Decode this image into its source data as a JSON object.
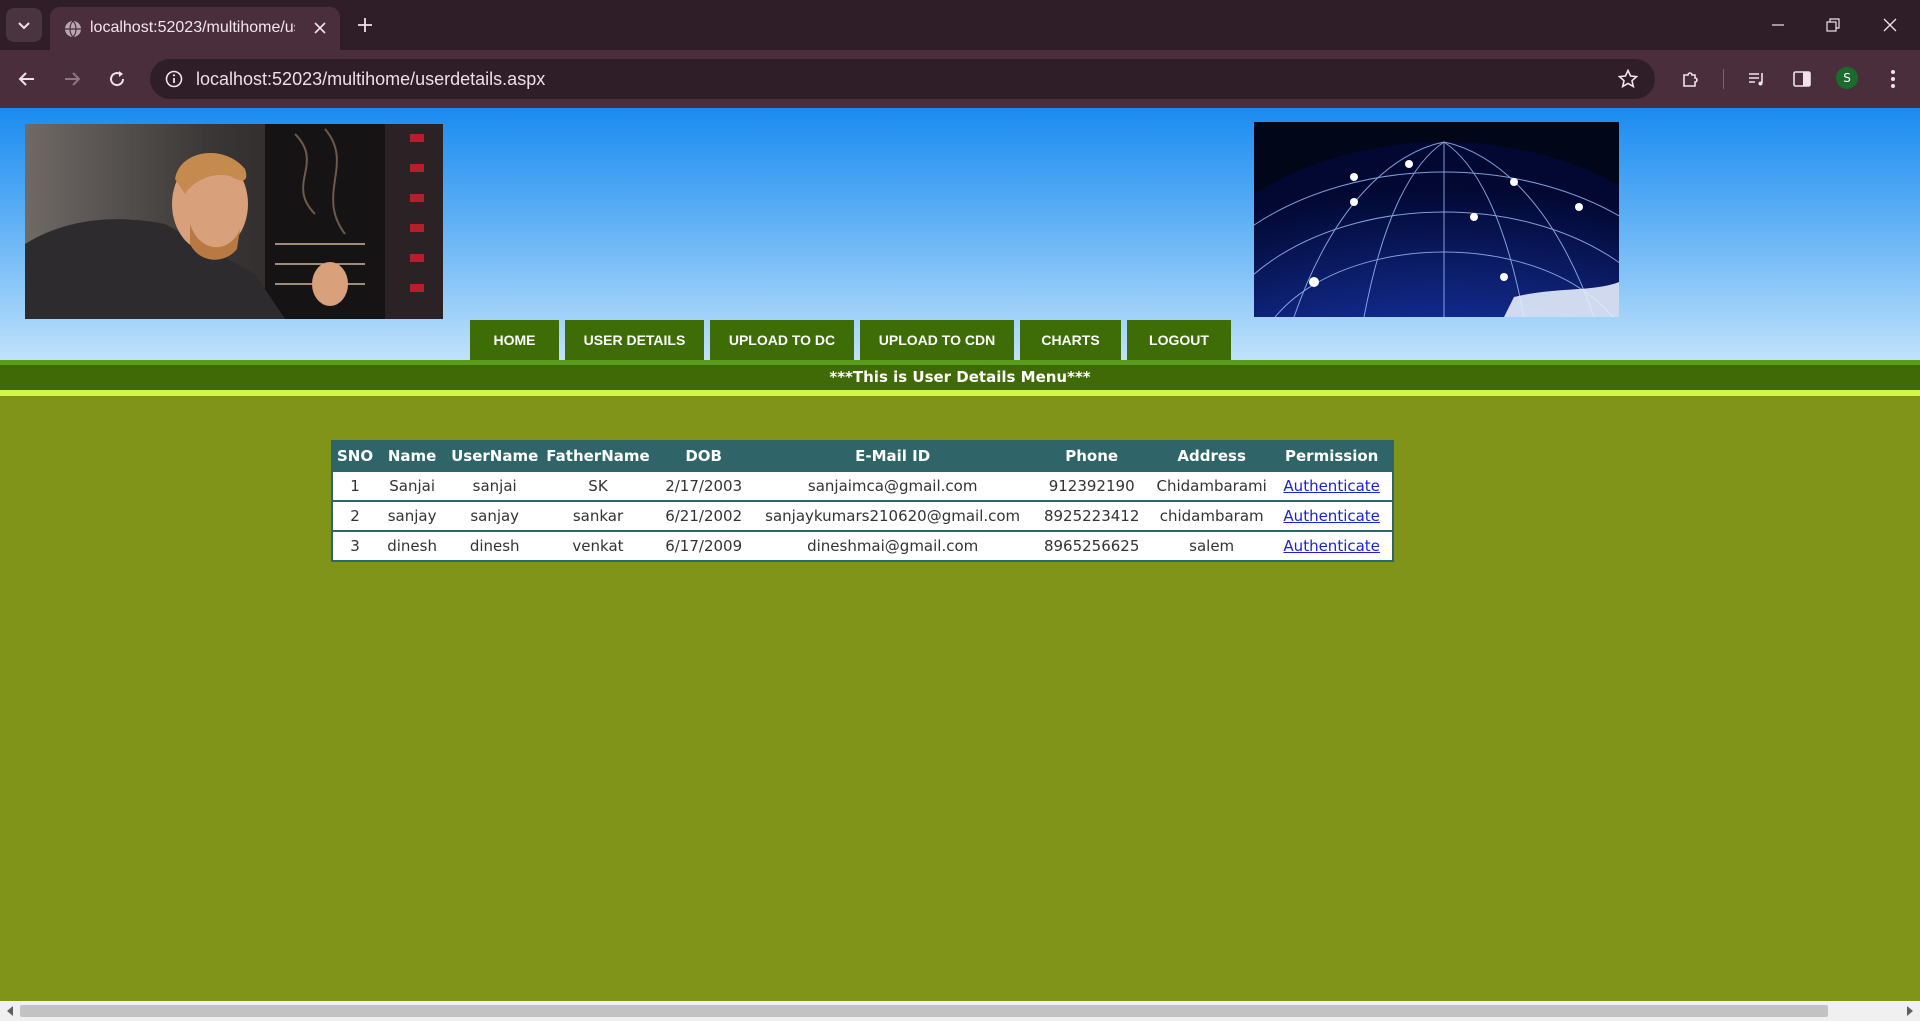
{
  "browser": {
    "tab_title": "localhost:52023/multihome/userdetails.aspx",
    "url": "localhost:52023/multihome/userdetails.aspx",
    "profile_initial": "S"
  },
  "page": {
    "menu": [
      "HOME",
      "USER DETAILS",
      "UPLOAD TO DC",
      "UPLOAD TO CDN",
      "CHARTS",
      "LOGOUT"
    ],
    "section_title": "***This is User Details Menu***",
    "images": {
      "left": "technician-working-on-server-rack",
      "right": "blue-globe-network"
    },
    "table": {
      "headers": [
        "SNO",
        "Name",
        "UserName",
        "FatherName",
        "DOB",
        "E-Mail ID",
        "Phone",
        "Address",
        "Permission"
      ],
      "rows": [
        [
          "1",
          "Sanjai",
          "sanjai",
          "SK",
          "2/17/2003",
          "sanjaimca@gmail.com",
          "912392190",
          "Chidambarami",
          "Authenticate"
        ],
        [
          "2",
          "sanjay",
          "sanjay",
          "sankar",
          "6/21/2002",
          "sanjaykumars210620@gmail.com",
          "8925223412",
          "chidambaram",
          "Authenticate"
        ],
        [
          "3",
          "dinesh",
          "dinesh",
          "venkat",
          "6/17/2009",
          "dineshmai@gmail.com",
          "8965256625",
          "salem",
          "Authenticate"
        ]
      ]
    }
  },
  "colors": {
    "page_bg": "#809419",
    "menu_bg": "#3e6c07",
    "grid_header": "#2f6568",
    "link": "#1a23d6"
  }
}
